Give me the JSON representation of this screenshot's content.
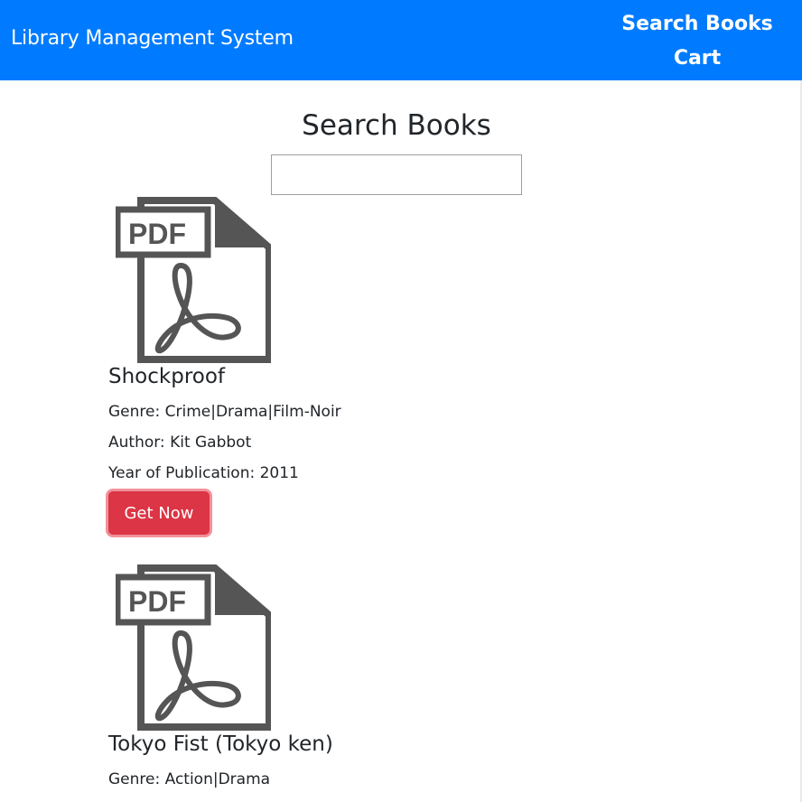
{
  "navbar": {
    "brand": "Library Management System",
    "links": [
      "Search Books",
      "Cart"
    ]
  },
  "main": {
    "title": "Search Books",
    "search": {
      "value": "",
      "placeholder": ""
    }
  },
  "books": [
    {
      "icon_text": "PDF",
      "title": "Shockproof",
      "genre": "Genre: Crime|Drama|Film-Noir",
      "author": "Author: Kit Gabbot",
      "year": "Year of Publication: 2011",
      "button": "Get Now"
    },
    {
      "icon_text": "PDF",
      "title": "Tokyo Fist (Tokyo ken)",
      "genre": "Genre: Action|Drama"
    }
  ],
  "colors": {
    "navbar": "#007bff",
    "button": "#dc3545",
    "button_focus_ring": "#f1919b",
    "icon": "#555555"
  },
  "icons": {
    "book": "pdf-file-icon"
  }
}
